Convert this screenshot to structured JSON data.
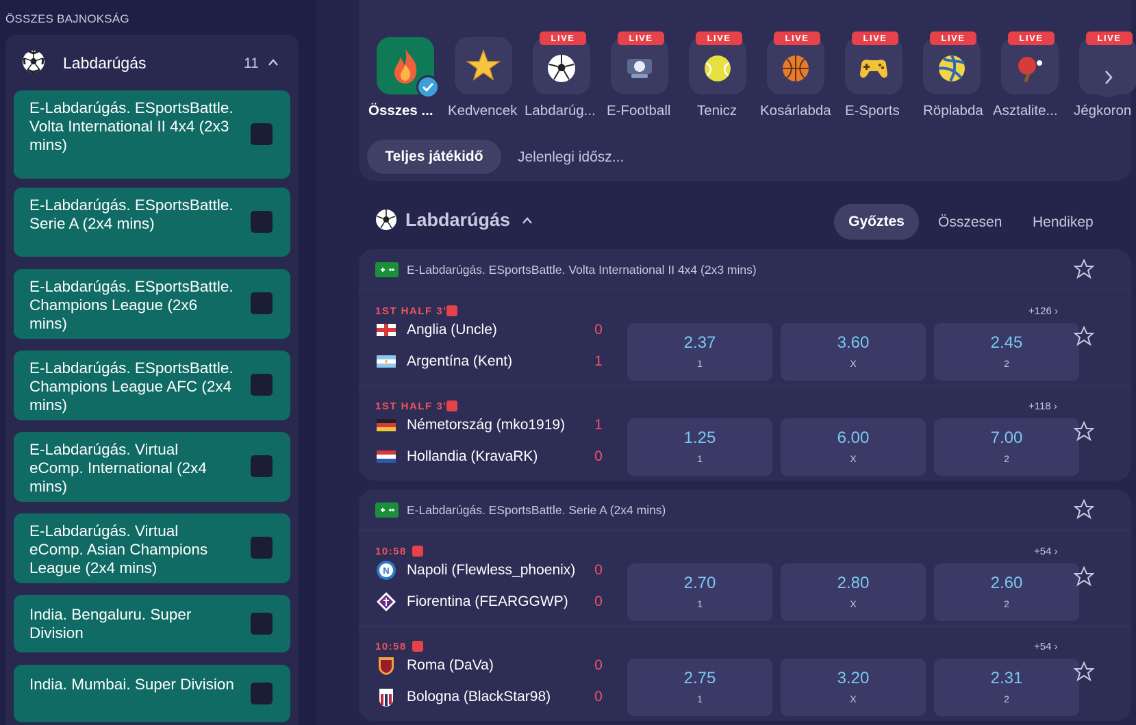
{
  "sidebar": {
    "title": "ÖSSZES BAJNOKSÁG",
    "sport": {
      "name": "Labdarúgás",
      "count": "11"
    },
    "leagues": [
      {
        "label": "E-Labdarúgás. ESportsBattle. Volta International II 4x4 (2x3 mins)"
      },
      {
        "label": "E-Labdarúgás. ESportsBattle. Serie A (2x4 mins)"
      },
      {
        "label": "E-Labdarúgás. ESportsBattle. Champions League (2x6 mins)"
      },
      {
        "label": "E-Labdarúgás. ESportsBattle. Champions League AFC (2x4 mins)"
      },
      {
        "label": "E-Labdarúgás. Virtual eComp. International (2x4 mins)"
      },
      {
        "label": "E-Labdarúgás. Virtual eComp. Asian Champions League (2x4 mins)"
      },
      {
        "label": "India. Bengaluru. Super Division"
      },
      {
        "label": "India. Mumbai. Super Division"
      }
    ]
  },
  "sports_bar": {
    "live_badge": "LIVE",
    "items": [
      {
        "label": "Összes ...",
        "icon": "fire-icon",
        "live": false,
        "active": true
      },
      {
        "label": "Kedvencek",
        "icon": "star-icon",
        "live": false
      },
      {
        "label": "Labdarúg...",
        "icon": "soccer-ball-icon",
        "live": true
      },
      {
        "label": "E-Football",
        "icon": "e-football-icon",
        "live": true
      },
      {
        "label": "Tenicz",
        "icon": "tennis-ball-icon",
        "live": true
      },
      {
        "label": "Kosárlabda",
        "icon": "basketball-icon",
        "live": true
      },
      {
        "label": "E-Sports",
        "icon": "gamepad-icon",
        "live": true
      },
      {
        "label": "Röplabda",
        "icon": "volleyball-icon",
        "live": true
      },
      {
        "label": "Asztalite...",
        "icon": "table-tennis-icon",
        "live": true
      },
      {
        "label": "Jégkoron",
        "icon": "hockey-icon",
        "live": true
      }
    ]
  },
  "period_tabs": {
    "active": "Teljes játékidő",
    "other": "Jelenlegi idősz..."
  },
  "section": {
    "title": "Labdarúgás",
    "market_tabs": [
      "Győztes",
      "Összesen",
      "Hendikep"
    ]
  },
  "league_cards": [
    {
      "name": "E-Labdarúgás. ESportsBattle. Volta International II 4x4 (2x3 mins)",
      "matches": [
        {
          "time": "1ST HALF 3'",
          "more": "+126 ›",
          "home": {
            "name": "Anglia (Uncle)",
            "score": "0"
          },
          "away": {
            "name": "Argentína (Kent)",
            "score": "1"
          },
          "odds": [
            {
              "value": "2.37",
              "label": "1"
            },
            {
              "value": "3.60",
              "label": "X"
            },
            {
              "value": "2.45",
              "label": "2"
            }
          ]
        },
        {
          "time": "1ST HALF 3'",
          "more": "+118 ›",
          "home": {
            "name": "Németország (mko1919)",
            "score": "1"
          },
          "away": {
            "name": "Hollandia (KravaRK)",
            "score": "0"
          },
          "odds": [
            {
              "value": "1.25",
              "label": "1"
            },
            {
              "value": "6.00",
              "label": "X"
            },
            {
              "value": "7.00",
              "label": "2"
            }
          ]
        }
      ]
    },
    {
      "name": "E-Labdarúgás. ESportsBattle. Serie A (2x4 mins)",
      "matches": [
        {
          "time": "10:58",
          "more": "+54 ›",
          "home": {
            "name": "Napoli (Flewless_phoenix)",
            "score": "0"
          },
          "away": {
            "name": "Fiorentina (FEARGGWP)",
            "score": "0"
          },
          "odds": [
            {
              "value": "2.70",
              "label": "1"
            },
            {
              "value": "2.80",
              "label": "X"
            },
            {
              "value": "2.60",
              "label": "2"
            }
          ]
        },
        {
          "time": "10:58",
          "more": "+54 ›",
          "home": {
            "name": "Roma (DaVa)",
            "score": "0"
          },
          "away": {
            "name": "Bologna (BlackStar98)",
            "score": "0"
          },
          "odds": [
            {
              "value": "2.75",
              "label": "1"
            },
            {
              "value": "3.20",
              "label": "X"
            },
            {
              "value": "2.31",
              "label": "2"
            }
          ]
        }
      ]
    }
  ],
  "colors": {
    "accent_teal": "#116b65",
    "live_red": "#e7424a",
    "odd_value": "#7cc7f0",
    "background": "#25244a"
  }
}
